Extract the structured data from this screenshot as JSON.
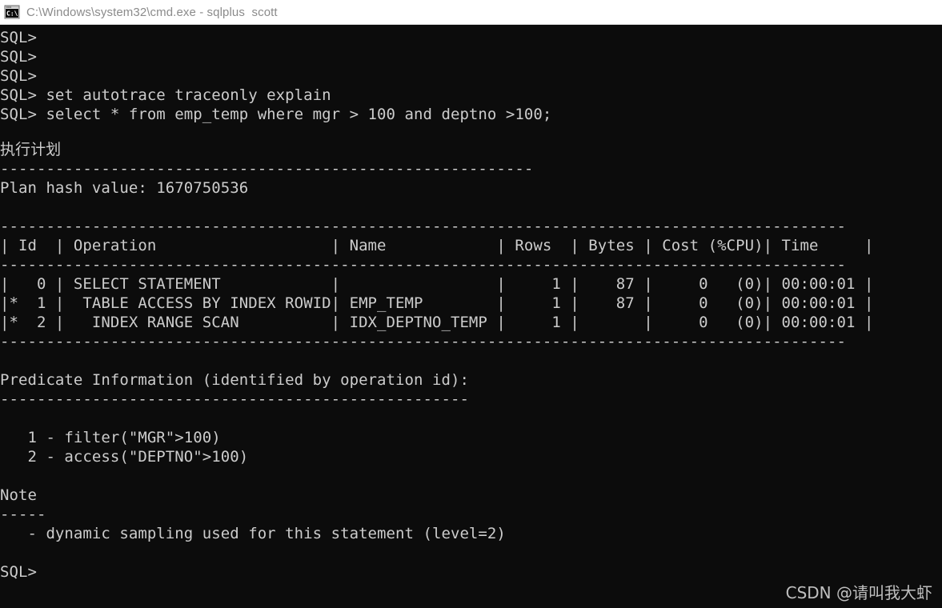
{
  "window": {
    "title": "C:\\Windows\\system32\\cmd.exe - sqlplus  scott",
    "icon": "cmd-console-icon",
    "icon_label": "C:\\",
    "background_color": "#0c0c0c",
    "foreground_color": "#cccccc",
    "titlebar_background": "#ffffff",
    "titlebar_text_color": "#8b8b8b"
  },
  "terminal": {
    "prompt": "SQL>",
    "lines": [
      "SQL>",
      "SQL>",
      "SQL>",
      "SQL> set autotrace traceonly explain",
      "SQL> select * from emp_temp where mgr > 100 and deptno >100;",
      "",
      "执行计划",
      "----------------------------------------------------------",
      "Plan hash value: 1670750536",
      "",
      "--------------------------------------------------------------------------------------------",
      "| Id  | Operation                   | Name            | Rows  | Bytes | Cost (%CPU)| Time     |",
      "--------------------------------------------------------------------------------------------",
      "|   0 | SELECT STATEMENT            |                 |     1 |    87 |     0   (0)| 00:00:01 |",
      "|*  1 |  TABLE ACCESS BY INDEX ROWID| EMP_TEMP        |     1 |    87 |     0   (0)| 00:00:01 |",
      "|*  2 |   INDEX RANGE SCAN          | IDX_DEPTNO_TEMP |     1 |       |     0   (0)| 00:00:01 |",
      "--------------------------------------------------------------------------------------------",
      "",
      "Predicate Information (identified by operation id):",
      "---------------------------------------------------",
      "",
      "   1 - filter(\"MGR\">100)",
      "   2 - access(\"DEPTNO\">100)",
      "",
      "Note",
      "-----",
      "   - dynamic sampling used for this statement (level=2)",
      "",
      "SQL>"
    ],
    "commands": [
      "set autotrace traceonly explain",
      "select * from emp_temp where mgr > 100 and deptno >100;"
    ],
    "plan_heading": "执行计划",
    "plan_hash_value": "Plan hash value: 1670750536",
    "predicate_heading": "Predicate Information (identified by operation id):",
    "predicates": [
      "   1 - filter(\"MGR\">100)",
      "   2 - access(\"DEPTNO\">100)"
    ],
    "note_heading": "Note",
    "note_items": [
      "   - dynamic sampling used for this statement (level=2)"
    ]
  },
  "execution_plan": {
    "columns": [
      "Id",
      "Operation",
      "Name",
      "Rows",
      "Bytes",
      "Cost (%CPU)",
      "Time"
    ],
    "rows": [
      {
        "star": "",
        "id": "0",
        "operation": "SELECT STATEMENT",
        "name": "",
        "rows": "1",
        "bytes": "87",
        "cost": "0",
        "cpu": "(0)",
        "time": "00:00:01"
      },
      {
        "star": "*",
        "id": "1",
        "operation": " TABLE ACCESS BY INDEX ROWID",
        "name": "EMP_TEMP",
        "rows": "1",
        "bytes": "87",
        "cost": "0",
        "cpu": "(0)",
        "time": "00:00:01"
      },
      {
        "star": "*",
        "id": "2",
        "operation": "  INDEX RANGE SCAN",
        "name": "IDX_DEPTNO_TEMP",
        "rows": "1",
        "bytes": "",
        "cost": "0",
        "cpu": "(0)",
        "time": "00:00:01"
      }
    ]
  },
  "watermark": {
    "text": "CSDN @请叫我大虾"
  }
}
